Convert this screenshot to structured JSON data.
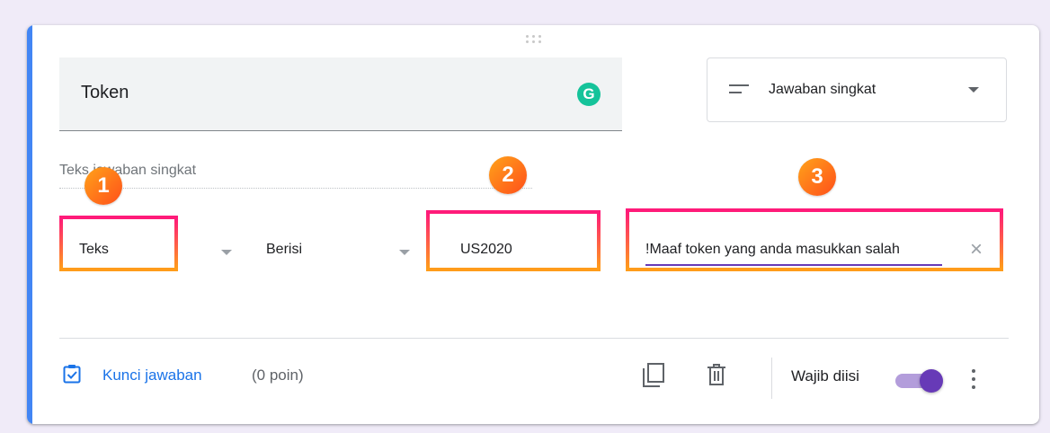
{
  "question": {
    "title": "Token",
    "type_label": "Jawaban singkat",
    "type_icon": "short-text-icon",
    "short_answer_placeholder": "Teks jawaban singkat"
  },
  "validation": {
    "type_value": "Teks",
    "condition_value": "Berisi",
    "text_value": "US2020",
    "error_text": "Maaf token yang anda masukkan salah!"
  },
  "annotations": [
    "1",
    "2",
    "3"
  ],
  "footer": {
    "answer_key_label": "Kunci jawaban",
    "points_label": "(0 poin)",
    "required_label": "Wajib diisi",
    "required_on": true,
    "icons": [
      "duplicate-icon",
      "trash-icon",
      "more-vert-icon"
    ]
  },
  "colors": {
    "accent": "#4285f4",
    "toggle": "#673ab7",
    "link": "#1a73e8"
  }
}
